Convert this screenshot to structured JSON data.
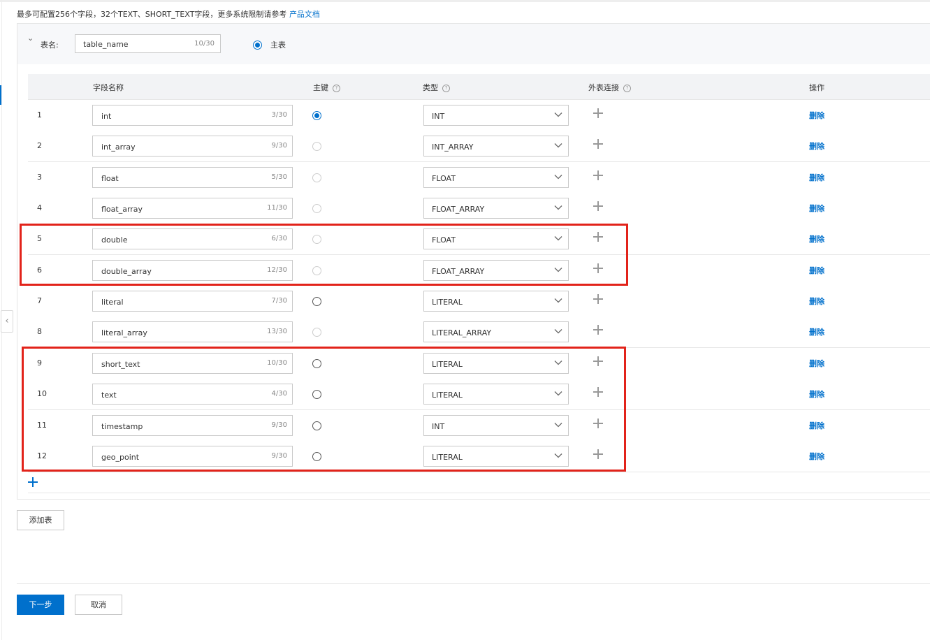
{
  "notice": {
    "text": "最多可配置256个字段，32个TEXT、SHORT_TEXT字段，更多系统限制请参考",
    "link": "产品文档"
  },
  "table_section": {
    "name_label": "表名:",
    "name_value": "table_name",
    "name_count": "10/30",
    "main_table_label": "主表"
  },
  "columns": {
    "field_name": "字段名称",
    "primary_key": "主键",
    "type": "类型",
    "foreign_join": "外表连接",
    "action": "操作"
  },
  "rows": [
    {
      "num": "1",
      "name": "int",
      "count": "3/30",
      "pk": "checked",
      "type": "INT",
      "action": "删除"
    },
    {
      "num": "2",
      "name": "int_array",
      "count": "9/30",
      "pk": "disabled",
      "type": "INT_ARRAY",
      "action": "删除"
    },
    {
      "num": "3",
      "name": "float",
      "count": "5/30",
      "pk": "disabled",
      "type": "FLOAT",
      "action": "删除"
    },
    {
      "num": "4",
      "name": "float_array",
      "count": "11/30",
      "pk": "disabled",
      "type": "FLOAT_ARRAY",
      "action": "删除"
    },
    {
      "num": "5",
      "name": "double",
      "count": "6/30",
      "pk": "disabled",
      "type": "FLOAT",
      "action": "删除"
    },
    {
      "num": "6",
      "name": "double_array",
      "count": "12/30",
      "pk": "disabled",
      "type": "FLOAT_ARRAY",
      "action": "删除"
    },
    {
      "num": "7",
      "name": "literal",
      "count": "7/30",
      "pk": "unchecked",
      "type": "LITERAL",
      "action": "删除"
    },
    {
      "num": "8",
      "name": "literal_array",
      "count": "13/30",
      "pk": "disabled",
      "type": "LITERAL_ARRAY",
      "action": "删除"
    },
    {
      "num": "9",
      "name": "short_text",
      "count": "10/30",
      "pk": "unchecked",
      "type": "LITERAL",
      "action": "删除"
    },
    {
      "num": "10",
      "name": "text",
      "count": "4/30",
      "pk": "unchecked",
      "type": "LITERAL",
      "action": "删除"
    },
    {
      "num": "11",
      "name": "timestamp",
      "count": "9/30",
      "pk": "unchecked",
      "type": "INT",
      "action": "删除"
    },
    {
      "num": "12",
      "name": "geo_point",
      "count": "9/30",
      "pk": "unchecked",
      "type": "LITERAL",
      "action": "删除"
    }
  ],
  "buttons": {
    "add_table": "添加表",
    "next": "下一步",
    "cancel": "取消"
  },
  "colors": {
    "accent": "#0070cc",
    "highlight": "#e2231a"
  },
  "icons": {
    "collapse": "chevron-down-icon",
    "help": "question-circle-icon",
    "dropdown": "chevron-down-icon",
    "add": "plus-icon",
    "sidebar_toggle": "chevron-left-icon"
  }
}
